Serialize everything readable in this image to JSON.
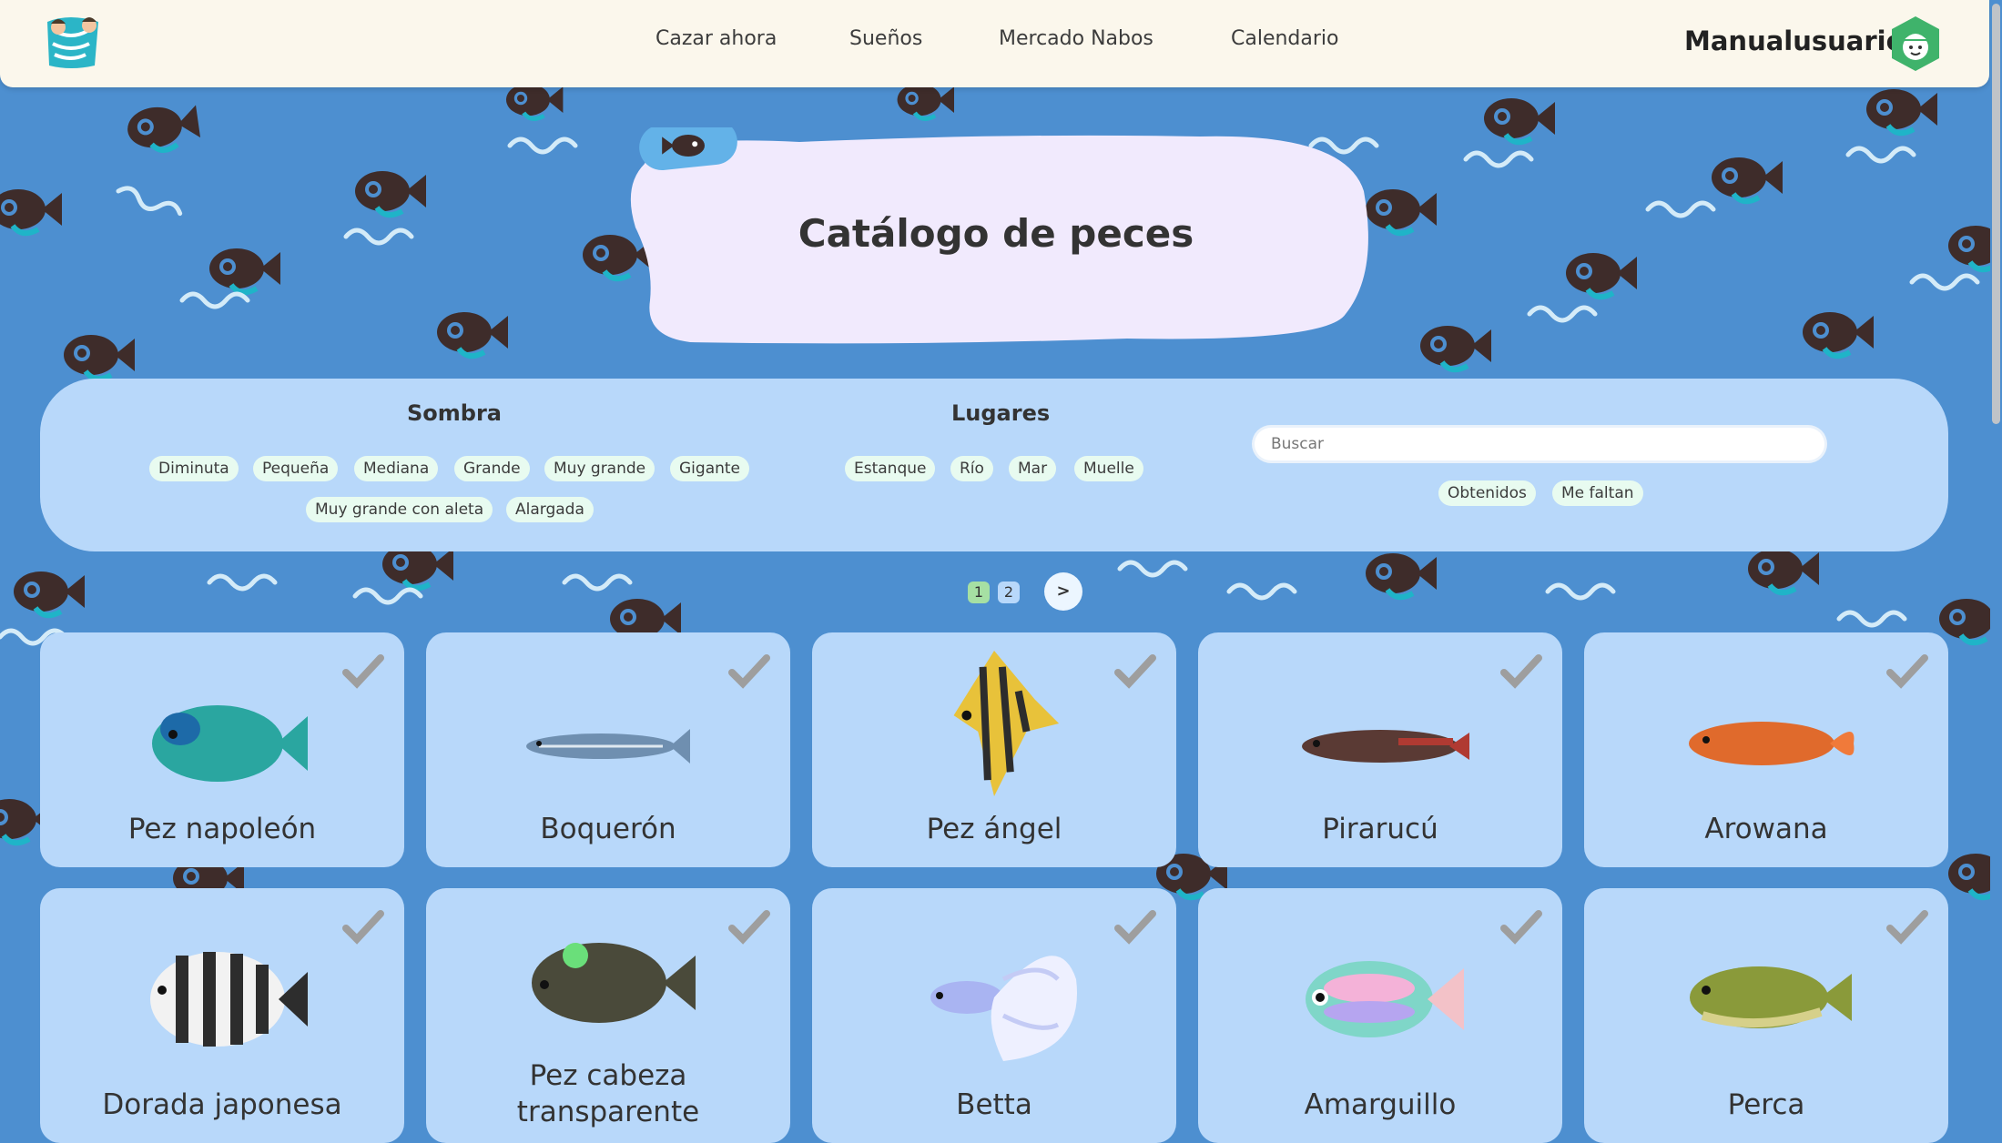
{
  "nav": {
    "links": [
      "Cazar ahora",
      "Sueños",
      "Mercado Nabos",
      "Calendario"
    ],
    "username": "Manualusuario"
  },
  "title": "Catálogo de peces",
  "filters": {
    "shadow_heading": "Sombra",
    "shadow_options": [
      "Diminuta",
      "Pequeña",
      "Mediana",
      "Grande",
      "Muy grande",
      "Gigante",
      "Muy grande con aleta",
      "Alargada"
    ],
    "places_heading": "Lugares",
    "places_options": [
      "Estanque",
      "Río",
      "Mar",
      "Muelle"
    ],
    "search_placeholder": "Buscar",
    "status_options": [
      "Obtenidos",
      "Me faltan"
    ]
  },
  "pagination": {
    "pages": [
      "1",
      "2"
    ],
    "current": "1",
    "next_label": ">"
  },
  "fish": [
    {
      "name": "Pez napoleón",
      "icon": "napoleon-fish-icon",
      "color": "#2aa6a0"
    },
    {
      "name": "Boquerón",
      "icon": "anchovy-icon",
      "color": "#6f8fb0"
    },
    {
      "name": "Pez ángel",
      "icon": "angelfish-icon",
      "color": "#e8c23a"
    },
    {
      "name": "Pirarucú",
      "icon": "arapaima-icon",
      "color": "#5a3a34"
    },
    {
      "name": "Arowana",
      "icon": "arowana-icon",
      "color": "#e06a2c"
    },
    {
      "name": "Dorada japonesa",
      "icon": "barred-knifejaw-icon",
      "color": "#2d2d2d"
    },
    {
      "name": "Pez cabeza transparente",
      "icon": "barreleye-icon",
      "color": "#4a4a3a"
    },
    {
      "name": "Betta",
      "icon": "betta-icon",
      "color": "#a9b4f2"
    },
    {
      "name": "Amarguillo",
      "icon": "bitterling-icon",
      "color": "#7fd6c8"
    },
    {
      "name": "Perca",
      "icon": "black-bass-icon",
      "color": "#8a9a3a"
    }
  ]
}
